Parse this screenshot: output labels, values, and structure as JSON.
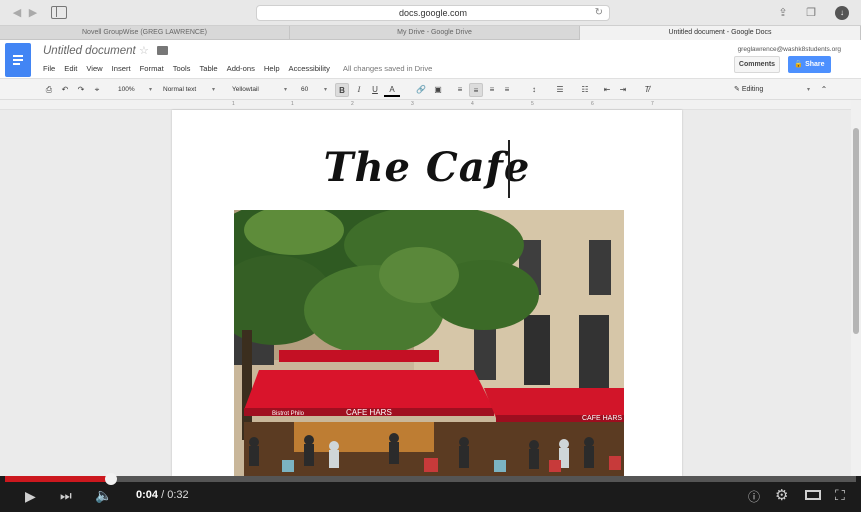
{
  "browser": {
    "url": "docs.google.com",
    "tabs": [
      {
        "title": "Novell GroupWise (GREG LAWRENCE)",
        "active": false
      },
      {
        "title": "My Drive - Google Drive",
        "active": false
      },
      {
        "title": "Untitled document - Google Docs",
        "active": true
      }
    ]
  },
  "docs": {
    "doc_title": "Untitled document",
    "account": "greglawrence@washk8students.org",
    "menu": [
      "File",
      "Edit",
      "View",
      "Insert",
      "Format",
      "Tools",
      "Table",
      "Add-ons",
      "Help",
      "Accessibility"
    ],
    "save_status": "All changes saved in Drive",
    "comments_label": "Comments",
    "share_label": "Share",
    "toolbar": {
      "zoom": "100%",
      "style": "Normal text",
      "font": "Yellowtail",
      "size": "60",
      "mode": "Editing"
    },
    "ruler_numbers": [
      "1",
      "1",
      "2",
      "3",
      "4",
      "5",
      "6",
      "7"
    ],
    "heading_text": "The Cafe"
  },
  "photo": {
    "awning_left": "CAFE HARS",
    "awning_right": "CAFE HARS",
    "bistro": "Bistrot Philo"
  },
  "player": {
    "current_time": "0:04",
    "total_time": "0:32",
    "progress_percent": 12.5
  },
  "colors": {
    "docs_blue": "#4285f4",
    "share_blue": "#4d90fe",
    "progress_red": "#cc181e",
    "awning_red": "#d9142b"
  }
}
